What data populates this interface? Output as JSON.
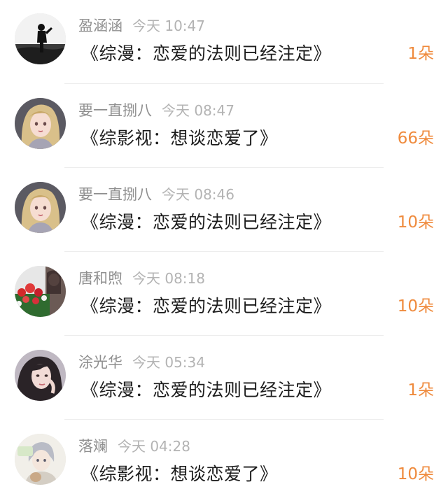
{
  "items": [
    {
      "username": "盈涵涵",
      "time": "今天 10:47",
      "title": "《综漫：恋爱的法则已经注定》",
      "flowers": "1朵",
      "avatar": "silhouette-seaside-avatar"
    },
    {
      "username": "要一直捌八",
      "time": "今天 08:47",
      "title": "《综影视：想谈恋爱了》",
      "flowers": "66朵",
      "avatar": "anime-girl-avatar"
    },
    {
      "username": "要一直捌八",
      "time": "今天 08:46",
      "title": "《综漫：恋爱的法则已经注定》",
      "flowers": "10朵",
      "avatar": "anime-girl-avatar"
    },
    {
      "username": "唐和煦",
      "time": "今天 08:18",
      "title": "《综漫：恋爱的法则已经注定》",
      "flowers": "10朵",
      "avatar": "flowers-photo-avatar"
    },
    {
      "username": "涂光华",
      "time": "今天 05:34",
      "title": "《综漫：恋爱的法则已经注定》",
      "flowers": "1朵",
      "avatar": "woman-portrait-avatar"
    },
    {
      "username": "落斓",
      "time": "今天 04:28",
      "title": "《综影视：想谈恋爱了》",
      "flowers": "10朵",
      "avatar": "anime-boy-avatar"
    }
  ],
  "colors": {
    "username": "#8f8f8f",
    "timestamp": "#b3b3b3",
    "title": "#1c1c1c",
    "flowers": "#ef8a3c",
    "divider": "#ededed"
  }
}
